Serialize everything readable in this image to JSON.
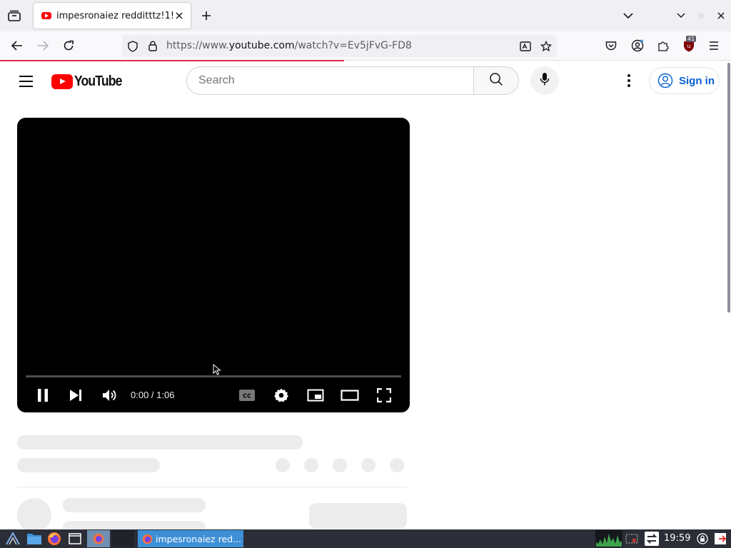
{
  "browser": {
    "tab": {
      "title": "impesronaiez redditttz!1!1"
    },
    "url": {
      "prefix": "https://www.",
      "domain": "youtube.com",
      "path": "/watch?v=Ev5jFvG-FD8"
    },
    "extension_badge": "41",
    "load_progress": 0.47
  },
  "youtube": {
    "logo_text": "YouTube",
    "search_placeholder": "Search",
    "sign_in_label": "Sign in"
  },
  "player": {
    "time_display": "0:00 / 1:06",
    "progress": 0.0,
    "state": "playing"
  },
  "taskbar": {
    "window_label": "impesronaiez red...",
    "clock": "19:59"
  },
  "colors": {
    "accent_red": "#ff0000",
    "firefox_load_bar": "#e22850",
    "link_blue": "#065fd4",
    "taskbar_bg": "#2b2e37",
    "taskbar_active": "#3d8fd6"
  },
  "icons": [
    "tab-list-icon",
    "youtube-favicon",
    "close-icon",
    "plus-icon",
    "chevron-down-icon",
    "minimize-icon",
    "maximize-icon",
    "window-close-icon",
    "back-arrow-icon",
    "forward-arrow-icon",
    "reload-icon",
    "shield-icon",
    "lock-icon",
    "translate-icon",
    "star-icon",
    "pocket-icon",
    "account-icon",
    "extensions-icon",
    "ublock-icon",
    "hamburger-menu-icon",
    "search-icon",
    "microphone-icon",
    "more-vert-icon",
    "user-circle-icon",
    "pause-icon",
    "next-icon",
    "volume-icon",
    "subtitles-icon",
    "settings-gear-icon",
    "miniplayer-icon",
    "theater-mode-icon",
    "fullscreen-icon",
    "mouse-cursor-icon",
    "app-menu-icon",
    "file-manager-icon",
    "firefox-icon",
    "terminal-icon",
    "cpu-graph-icon",
    "network-icon",
    "workspace-icon",
    "lock-screen-icon",
    "logout-icon"
  ]
}
